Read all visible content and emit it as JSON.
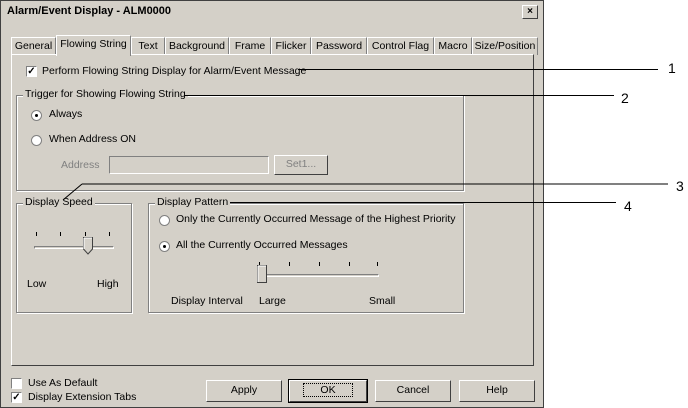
{
  "window": {
    "title": "Alarm/Event Display - ALM0000",
    "close_glyph": "×"
  },
  "tabs": [
    {
      "label": "General"
    },
    {
      "label": "Flowing String"
    },
    {
      "label": "Text"
    },
    {
      "label": "Background"
    },
    {
      "label": "Frame"
    },
    {
      "label": "Flicker"
    },
    {
      "label": "Password"
    },
    {
      "label": "Control Flag"
    },
    {
      "label": "Macro"
    },
    {
      "label": "Size/Position"
    }
  ],
  "active_tab": "Flowing String",
  "perform_checkbox": {
    "label": "Perform Flowing String Display for Alarm/Event Message",
    "checked": true
  },
  "trigger_group": {
    "title": "Trigger for Showing Flowing String",
    "options": [
      {
        "label": "Always",
        "selected": true
      },
      {
        "label": "When Address ON",
        "selected": false
      }
    ],
    "address_label": "Address",
    "address_value": "",
    "set_button": "Set1..."
  },
  "display_speed": {
    "title": "Display Speed",
    "low_label": "Low",
    "high_label": "High",
    "level": 0.67
  },
  "display_pattern": {
    "title": "Display Pattern",
    "options": [
      {
        "label": "Only the Currently Occurred Message of the Highest Priority",
        "selected": false
      },
      {
        "label": "All the Currently Occurred Messages",
        "selected": true
      }
    ],
    "interval_label": "Display Interval",
    "large_label": "Large",
    "small_label": "Small",
    "level": 0.0
  },
  "footer": {
    "use_default": {
      "label": "Use As Default",
      "checked": false
    },
    "ext_tabs": {
      "label": "Display Extension Tabs",
      "checked": true
    },
    "apply": "Apply",
    "ok": "OK",
    "cancel": "Cancel",
    "help": "Help"
  },
  "callouts": [
    "1",
    "2",
    "3",
    "4"
  ],
  "check_glyph": "✓"
}
